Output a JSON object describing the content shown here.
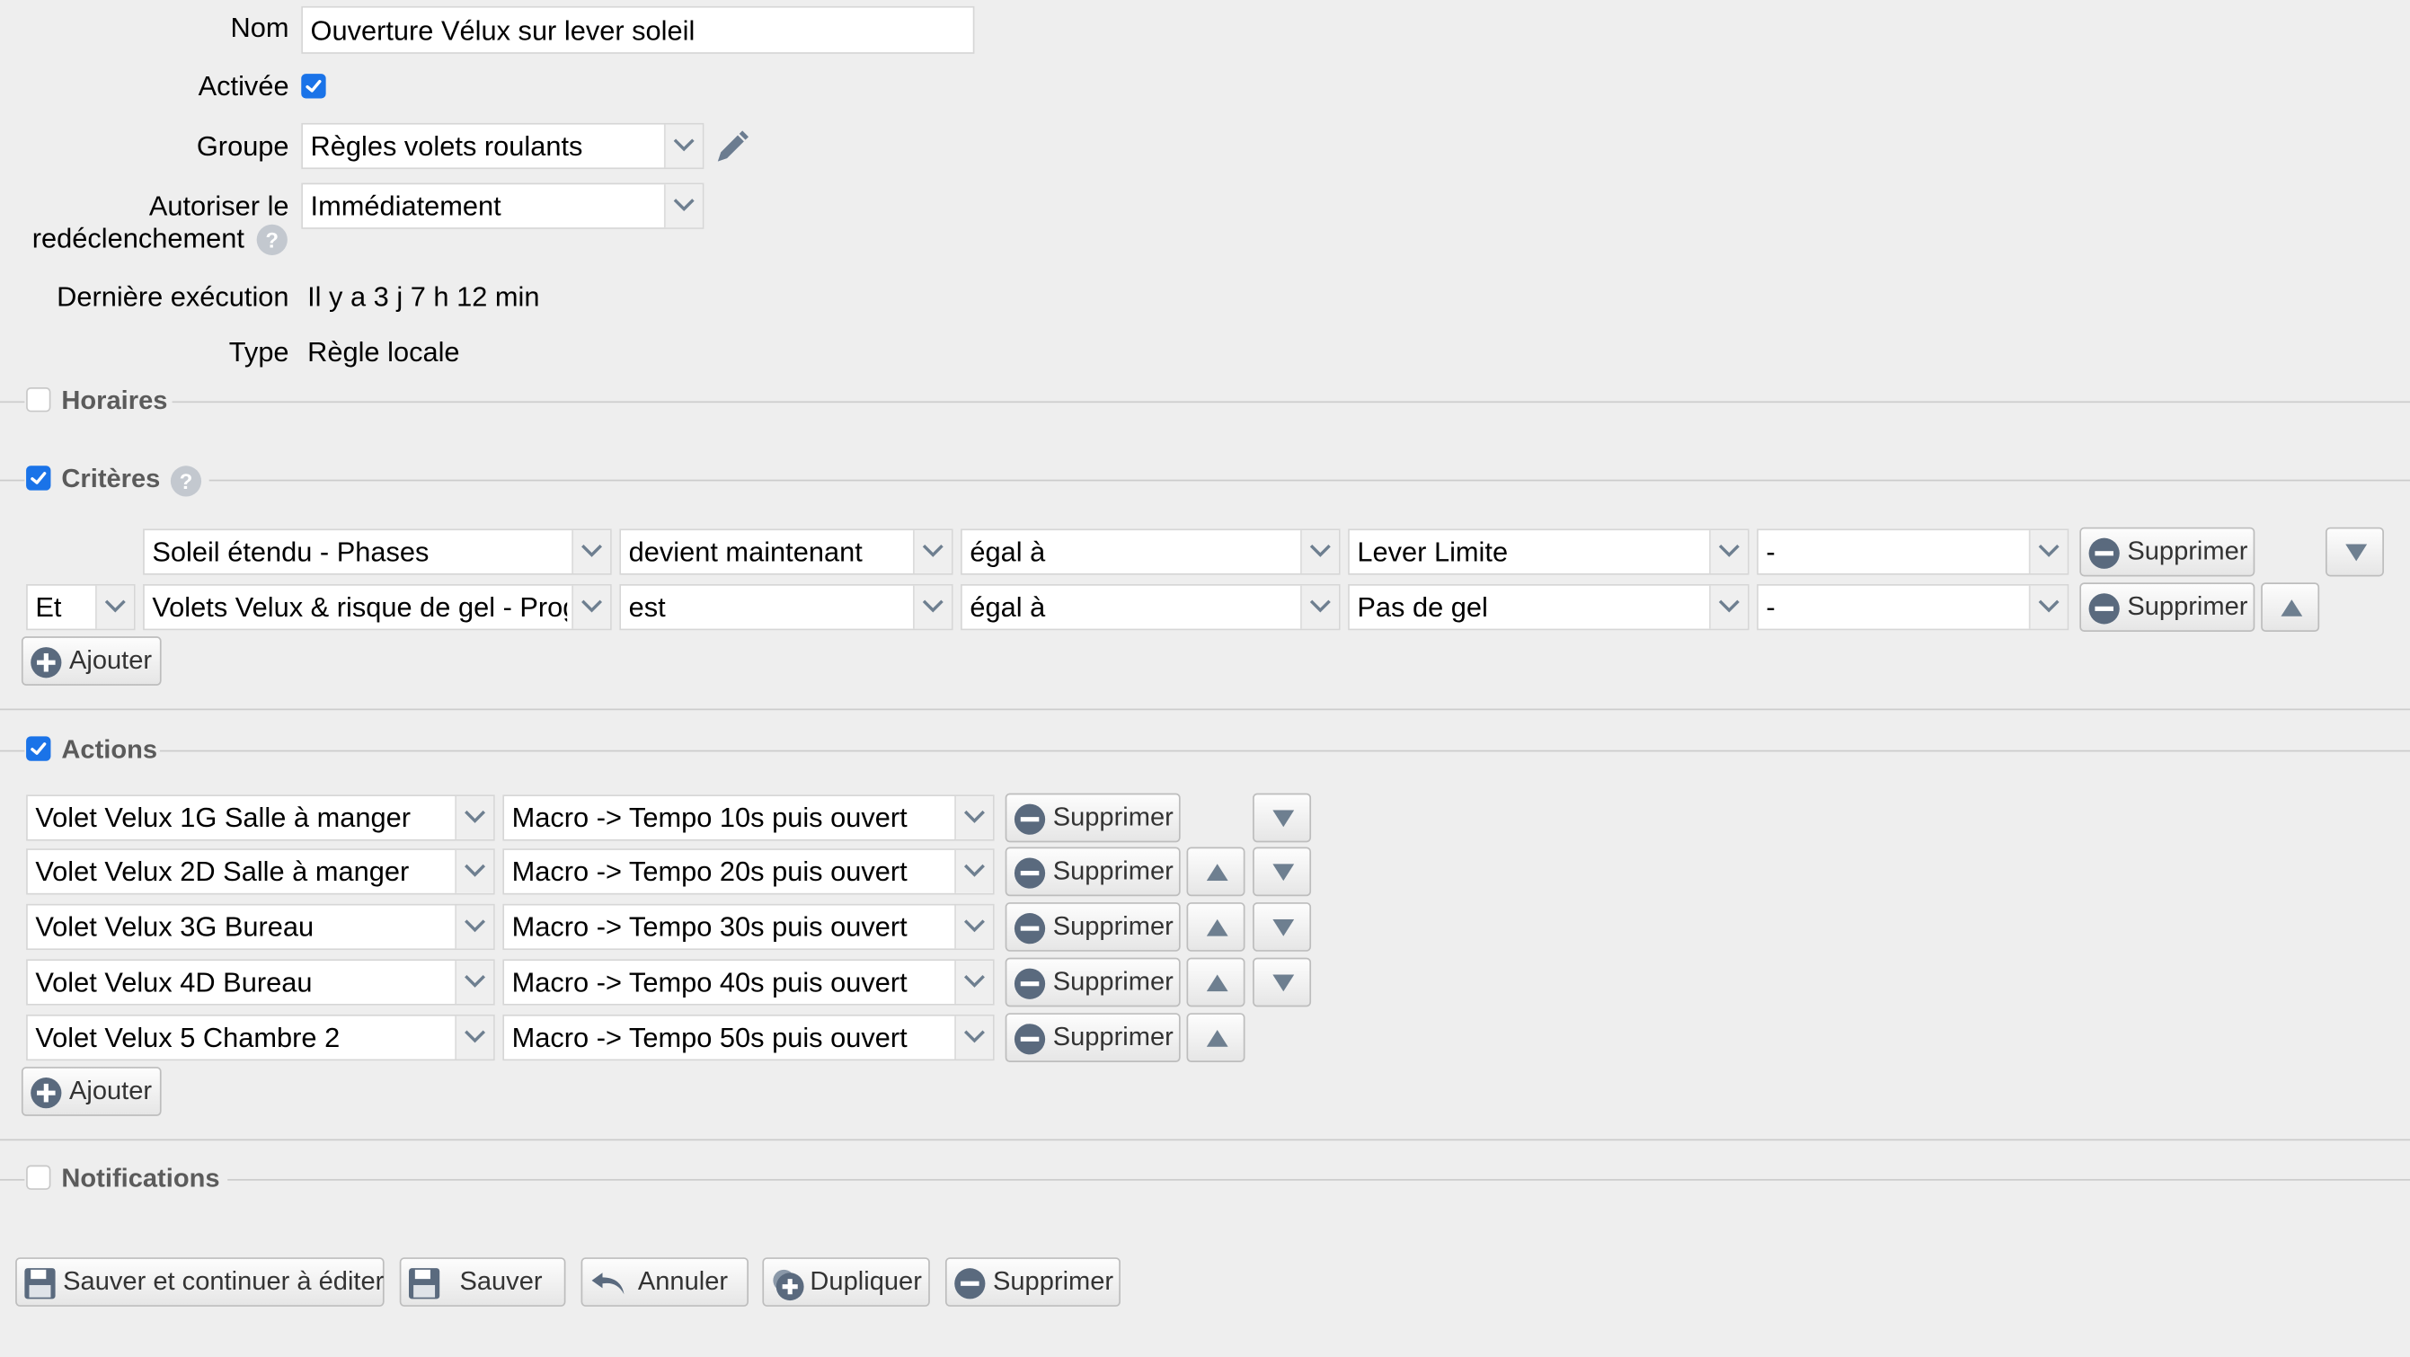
{
  "form": {
    "name_label": "Nom",
    "name_value": "Ouverture Vélux sur lever soleil",
    "active_label": "Activée",
    "active_checked": true,
    "group_label": "Groupe",
    "group_value": "Règles volets roulants",
    "retrigger_label_line1": "Autoriser le",
    "retrigger_label_line2": "redéclenchement",
    "retrigger_value": "Immédiatement",
    "last_exec_label": "Dernière exécution",
    "last_exec_value": "Il y a 3 j 7 h 12 min",
    "type_label": "Type",
    "type_value": "Règle locale",
    "help_glyph": "?"
  },
  "sections": {
    "schedules": "Horaires",
    "criteria": "Critères",
    "actions": "Actions",
    "notifications": "Notifications"
  },
  "criteria": [
    {
      "conjunction": "",
      "subject": "Soleil étendu - Phases",
      "event": "devient maintenant",
      "operator": "égal à",
      "value": "Lever Limite",
      "extra": "-",
      "delete": "Supprimer"
    },
    {
      "conjunction": "Et",
      "subject": "Volets Velux & risque de gel - Programme",
      "event": "est",
      "operator": "égal à",
      "value": "Pas de gel",
      "extra": "-",
      "delete": "Supprimer"
    }
  ],
  "criteria_add": "Ajouter",
  "actions": [
    {
      "device": "Volet Velux 1G Salle à manger",
      "command": "Macro -> Tempo 10s puis ouvert",
      "delete": "Supprimer"
    },
    {
      "device": "Volet Velux 2D Salle à manger",
      "command": "Macro -> Tempo 20s puis ouvert",
      "delete": "Supprimer"
    },
    {
      "device": "Volet Velux 3G Bureau",
      "command": "Macro -> Tempo 30s puis ouvert",
      "delete": "Supprimer"
    },
    {
      "device": "Volet Velux 4D Bureau",
      "command": "Macro -> Tempo 40s puis ouvert",
      "delete": "Supprimer"
    },
    {
      "device": "Volet Velux 5 Chambre 2",
      "command": "Macro -> Tempo 50s puis ouvert",
      "delete": "Supprimer"
    }
  ],
  "actions_add": "Ajouter",
  "footer": {
    "save_continue": "Sauver et continuer à éditer",
    "save": "Sauver",
    "cancel": "Annuler",
    "duplicate": "Dupliquer",
    "delete": "Supprimer"
  },
  "colors": {
    "accent": "#1a73e8",
    "background": "#eeeeee",
    "icon": "#5a6a7e"
  }
}
